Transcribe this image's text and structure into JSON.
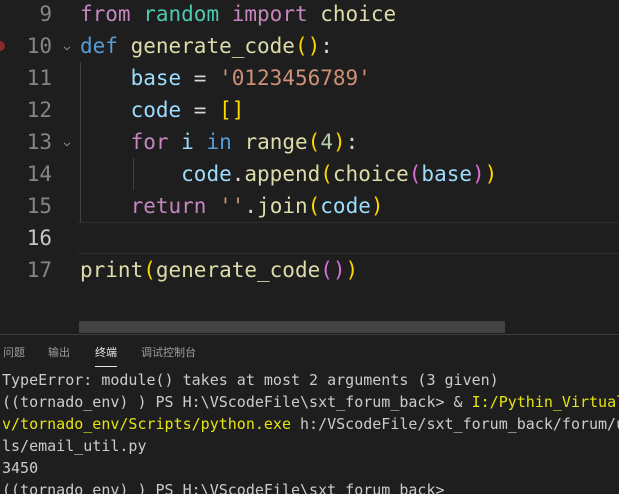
{
  "editor": {
    "lines": [
      {
        "num": "9",
        "tokens": [
          [
            "kw",
            "from"
          ],
          [
            "pun",
            " "
          ],
          [
            "cls",
            "random"
          ],
          [
            "pun",
            " "
          ],
          [
            "kw",
            "import"
          ],
          [
            "pun",
            " "
          ],
          [
            "fn",
            "choice"
          ]
        ]
      },
      {
        "num": "10",
        "fold": "chevron-down",
        "tokens": [
          [
            "kwb",
            "def"
          ],
          [
            "pun",
            " "
          ],
          [
            "fn",
            "generate_code"
          ],
          [
            "br1",
            "()"
          ],
          [
            "pun",
            ":"
          ]
        ]
      },
      {
        "num": "11",
        "tokens": [
          [
            "pun",
            "    "
          ],
          [
            "var",
            "base"
          ],
          [
            "pun",
            " = "
          ],
          [
            "str",
            "'0123456789'"
          ]
        ]
      },
      {
        "num": "12",
        "tokens": [
          [
            "pun",
            "    "
          ],
          [
            "var",
            "code"
          ],
          [
            "pun",
            " = "
          ],
          [
            "br1",
            "[]"
          ]
        ]
      },
      {
        "num": "13",
        "fold": "chevron-down",
        "tokens": [
          [
            "pun",
            "    "
          ],
          [
            "kw",
            "for"
          ],
          [
            "pun",
            " "
          ],
          [
            "var",
            "i"
          ],
          [
            "pun",
            " "
          ],
          [
            "kwb",
            "in"
          ],
          [
            "pun",
            " "
          ],
          [
            "fn",
            "range"
          ],
          [
            "br1",
            "("
          ],
          [
            "num",
            "4"
          ],
          [
            "br1",
            ")"
          ],
          [
            "pun",
            ":"
          ]
        ]
      },
      {
        "num": "14",
        "tokens": [
          [
            "pun",
            "        "
          ],
          [
            "var",
            "code"
          ],
          [
            "pun",
            "."
          ],
          [
            "fn",
            "append"
          ],
          [
            "br1",
            "("
          ],
          [
            "fn",
            "choice"
          ],
          [
            "br2",
            "("
          ],
          [
            "var",
            "base"
          ],
          [
            "br2",
            ")"
          ],
          [
            "br1",
            ")"
          ]
        ]
      },
      {
        "num": "15",
        "tokens": [
          [
            "pun",
            "    "
          ],
          [
            "kw",
            "return"
          ],
          [
            "pun",
            " "
          ],
          [
            "str",
            "''"
          ],
          [
            "pun",
            "."
          ],
          [
            "fn",
            "join"
          ],
          [
            "br1",
            "("
          ],
          [
            "var",
            "code"
          ],
          [
            "br1",
            ")"
          ]
        ]
      },
      {
        "num": "16",
        "active": true,
        "tokens": []
      },
      {
        "num": "17",
        "tokens": [
          [
            "fn",
            "print"
          ],
          [
            "br1",
            "("
          ],
          [
            "fn",
            "generate_code"
          ],
          [
            "br2",
            "()"
          ],
          [
            "br1",
            ")"
          ]
        ]
      }
    ]
  },
  "panel": {
    "tabs": [
      {
        "label": "问题",
        "active": false
      },
      {
        "label": "输出",
        "active": false
      },
      {
        "label": "终端",
        "active": true
      },
      {
        "label": "调试控制台",
        "active": false
      }
    ]
  },
  "terminal": {
    "lines": [
      {
        "segments": [
          {
            "text": "TypeError: module() takes at most 2 arguments (3 given)"
          }
        ]
      },
      {
        "segments": [
          {
            "text": "((tornado_env) ) PS H:\\VScodeFile\\sxt_forum_back> & "
          },
          {
            "text": "I:/Pythin_Virtual",
            "color": "yellow"
          }
        ]
      },
      {
        "segments": [
          {
            "text": "v/tornado_env/Scripts/python.exe",
            "color": "yellow"
          },
          {
            "text": " h:/VScodeFile/sxt_forum_back/forum/u"
          }
        ]
      },
      {
        "segments": [
          {
            "text": "ls/email_util.py"
          }
        ]
      },
      {
        "segments": [
          {
            "text": "3450"
          }
        ]
      },
      {
        "segments": [
          {
            "text": "((tornado_env) ) PS H:\\VScodeFile\\sxt_forum_back>"
          }
        ]
      }
    ]
  },
  "colors": {
    "background": "#1e1e1e",
    "keyword": "#c586c0",
    "storage": "#569cd6",
    "function": "#dcdcaa",
    "variable": "#9cdcfe",
    "string": "#ce9178",
    "number": "#b5cea8",
    "class": "#4ec9b0",
    "terminal_yellow": "#e5e510"
  }
}
